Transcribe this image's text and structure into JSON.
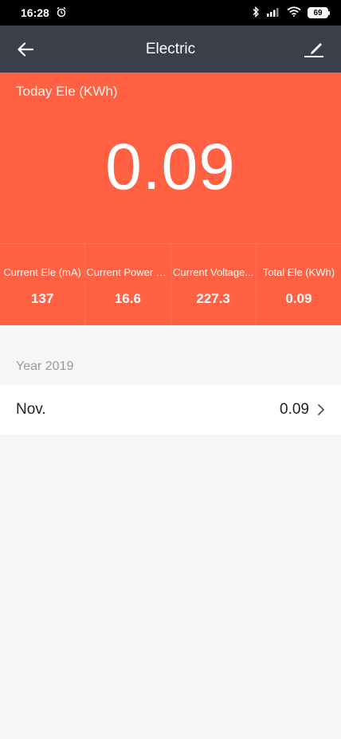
{
  "status_bar": {
    "time": "16:28",
    "battery": "69"
  },
  "header": {
    "title": "Electric"
  },
  "today": {
    "label": "Today Ele (KWh)",
    "value": "0.09"
  },
  "stats": [
    {
      "label": "Current Ele (mA)",
      "value": "137"
    },
    {
      "label": "Current Power (W)",
      "value": "16.6"
    },
    {
      "label": "Current Voltage...",
      "value": "227.3"
    },
    {
      "label": "Total Ele (KWh)",
      "value": "0.09"
    }
  ],
  "history": {
    "year_label": "Year 2019",
    "months": [
      {
        "name": "Nov.",
        "value": "0.09"
      }
    ]
  },
  "colors": {
    "accent": "#ff6142",
    "header_bg": "#3a3f4a",
    "page_bg": "#f6f6f6"
  }
}
